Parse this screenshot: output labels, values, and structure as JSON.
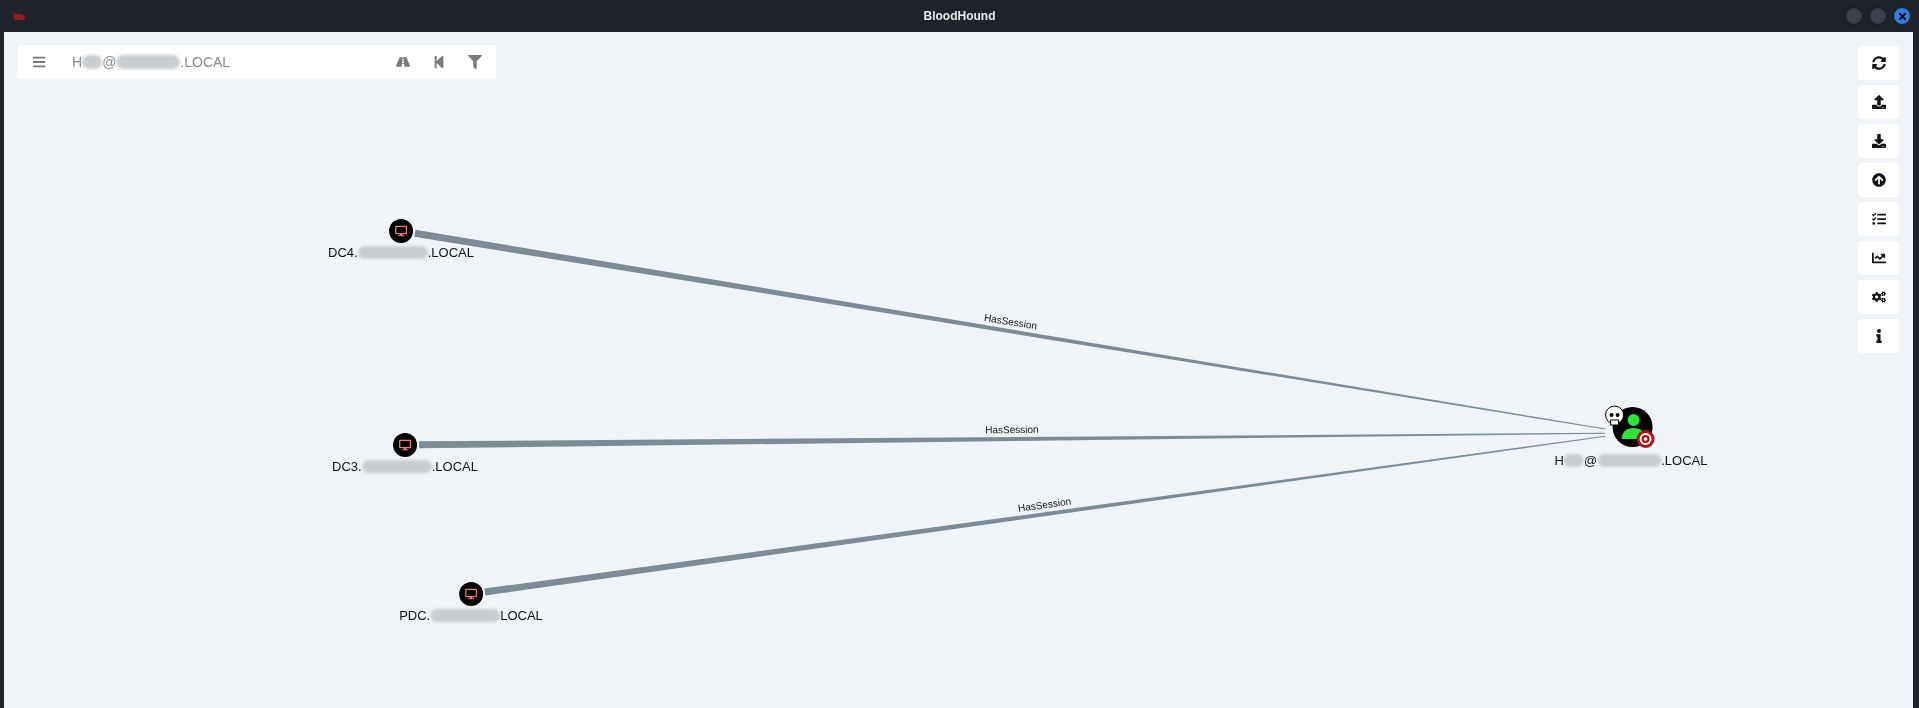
{
  "window": {
    "title": "BloodHound"
  },
  "search": {
    "value_segments": [
      {
        "kind": "text",
        "text": "H"
      },
      {
        "kind": "redacted"
      },
      {
        "kind": "text",
        "text": "@"
      },
      {
        "kind": "redacted"
      },
      {
        "kind": "text",
        "text": ".LOCAL"
      }
    ]
  },
  "nodes": [
    {
      "kind": "computer",
      "label": [
        {
          "kind": "text",
          "text": "DC4."
        },
        {
          "kind": "redacted"
        },
        {
          "kind": "text",
          "text": ".LOCAL"
        }
      ]
    },
    {
      "kind": "computer",
      "label": [
        {
          "kind": "text",
          "text": "DC3."
        },
        {
          "kind": "redacted"
        },
        {
          "kind": "text",
          "text": ".LOCAL"
        }
      ]
    },
    {
      "kind": "computer",
      "label": [
        {
          "kind": "text",
          "text": "PDC."
        },
        {
          "kind": "redacted"
        },
        {
          "kind": "text",
          "text": "LOCAL"
        }
      ]
    },
    {
      "kind": "user",
      "owned": true,
      "high_value": true,
      "label": [
        {
          "kind": "text",
          "text": "H"
        },
        {
          "kind": "redacted"
        },
        {
          "kind": "text",
          "text": "@"
        },
        {
          "kind": "redacted"
        },
        {
          "kind": "text",
          "text": ".LOCAL"
        }
      ]
    }
  ],
  "edges": [
    {
      "label": "HasSession"
    },
    {
      "label": "HasSession"
    },
    {
      "label": "HasSession"
    }
  ]
}
